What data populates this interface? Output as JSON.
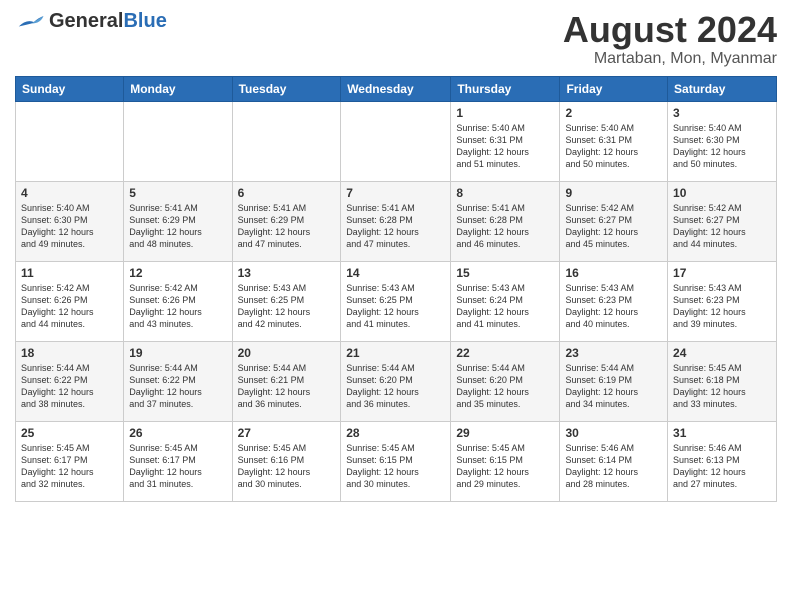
{
  "logo": {
    "part1": "General",
    "part2": "Blue"
  },
  "title": "August 2024",
  "subtitle": "Martaban, Mon, Myanmar",
  "days_header": [
    "Sunday",
    "Monday",
    "Tuesday",
    "Wednesday",
    "Thursday",
    "Friday",
    "Saturday"
  ],
  "weeks": [
    [
      {
        "num": "",
        "info": ""
      },
      {
        "num": "",
        "info": ""
      },
      {
        "num": "",
        "info": ""
      },
      {
        "num": "",
        "info": ""
      },
      {
        "num": "1",
        "info": "Sunrise: 5:40 AM\nSunset: 6:31 PM\nDaylight: 12 hours\nand 51 minutes."
      },
      {
        "num": "2",
        "info": "Sunrise: 5:40 AM\nSunset: 6:31 PM\nDaylight: 12 hours\nand 50 minutes."
      },
      {
        "num": "3",
        "info": "Sunrise: 5:40 AM\nSunset: 6:30 PM\nDaylight: 12 hours\nand 50 minutes."
      }
    ],
    [
      {
        "num": "4",
        "info": "Sunrise: 5:40 AM\nSunset: 6:30 PM\nDaylight: 12 hours\nand 49 minutes."
      },
      {
        "num": "5",
        "info": "Sunrise: 5:41 AM\nSunset: 6:29 PM\nDaylight: 12 hours\nand 48 minutes."
      },
      {
        "num": "6",
        "info": "Sunrise: 5:41 AM\nSunset: 6:29 PM\nDaylight: 12 hours\nand 47 minutes."
      },
      {
        "num": "7",
        "info": "Sunrise: 5:41 AM\nSunset: 6:28 PM\nDaylight: 12 hours\nand 47 minutes."
      },
      {
        "num": "8",
        "info": "Sunrise: 5:41 AM\nSunset: 6:28 PM\nDaylight: 12 hours\nand 46 minutes."
      },
      {
        "num": "9",
        "info": "Sunrise: 5:42 AM\nSunset: 6:27 PM\nDaylight: 12 hours\nand 45 minutes."
      },
      {
        "num": "10",
        "info": "Sunrise: 5:42 AM\nSunset: 6:27 PM\nDaylight: 12 hours\nand 44 minutes."
      }
    ],
    [
      {
        "num": "11",
        "info": "Sunrise: 5:42 AM\nSunset: 6:26 PM\nDaylight: 12 hours\nand 44 minutes."
      },
      {
        "num": "12",
        "info": "Sunrise: 5:42 AM\nSunset: 6:26 PM\nDaylight: 12 hours\nand 43 minutes."
      },
      {
        "num": "13",
        "info": "Sunrise: 5:43 AM\nSunset: 6:25 PM\nDaylight: 12 hours\nand 42 minutes."
      },
      {
        "num": "14",
        "info": "Sunrise: 5:43 AM\nSunset: 6:25 PM\nDaylight: 12 hours\nand 41 minutes."
      },
      {
        "num": "15",
        "info": "Sunrise: 5:43 AM\nSunset: 6:24 PM\nDaylight: 12 hours\nand 41 minutes."
      },
      {
        "num": "16",
        "info": "Sunrise: 5:43 AM\nSunset: 6:23 PM\nDaylight: 12 hours\nand 40 minutes."
      },
      {
        "num": "17",
        "info": "Sunrise: 5:43 AM\nSunset: 6:23 PM\nDaylight: 12 hours\nand 39 minutes."
      }
    ],
    [
      {
        "num": "18",
        "info": "Sunrise: 5:44 AM\nSunset: 6:22 PM\nDaylight: 12 hours\nand 38 minutes."
      },
      {
        "num": "19",
        "info": "Sunrise: 5:44 AM\nSunset: 6:22 PM\nDaylight: 12 hours\nand 37 minutes."
      },
      {
        "num": "20",
        "info": "Sunrise: 5:44 AM\nSunset: 6:21 PM\nDaylight: 12 hours\nand 36 minutes."
      },
      {
        "num": "21",
        "info": "Sunrise: 5:44 AM\nSunset: 6:20 PM\nDaylight: 12 hours\nand 36 minutes."
      },
      {
        "num": "22",
        "info": "Sunrise: 5:44 AM\nSunset: 6:20 PM\nDaylight: 12 hours\nand 35 minutes."
      },
      {
        "num": "23",
        "info": "Sunrise: 5:44 AM\nSunset: 6:19 PM\nDaylight: 12 hours\nand 34 minutes."
      },
      {
        "num": "24",
        "info": "Sunrise: 5:45 AM\nSunset: 6:18 PM\nDaylight: 12 hours\nand 33 minutes."
      }
    ],
    [
      {
        "num": "25",
        "info": "Sunrise: 5:45 AM\nSunset: 6:17 PM\nDaylight: 12 hours\nand 32 minutes."
      },
      {
        "num": "26",
        "info": "Sunrise: 5:45 AM\nSunset: 6:17 PM\nDaylight: 12 hours\nand 31 minutes."
      },
      {
        "num": "27",
        "info": "Sunrise: 5:45 AM\nSunset: 6:16 PM\nDaylight: 12 hours\nand 30 minutes."
      },
      {
        "num": "28",
        "info": "Sunrise: 5:45 AM\nSunset: 6:15 PM\nDaylight: 12 hours\nand 30 minutes."
      },
      {
        "num": "29",
        "info": "Sunrise: 5:45 AM\nSunset: 6:15 PM\nDaylight: 12 hours\nand 29 minutes."
      },
      {
        "num": "30",
        "info": "Sunrise: 5:46 AM\nSunset: 6:14 PM\nDaylight: 12 hours\nand 28 minutes."
      },
      {
        "num": "31",
        "info": "Sunrise: 5:46 AM\nSunset: 6:13 PM\nDaylight: 12 hours\nand 27 minutes."
      }
    ]
  ]
}
